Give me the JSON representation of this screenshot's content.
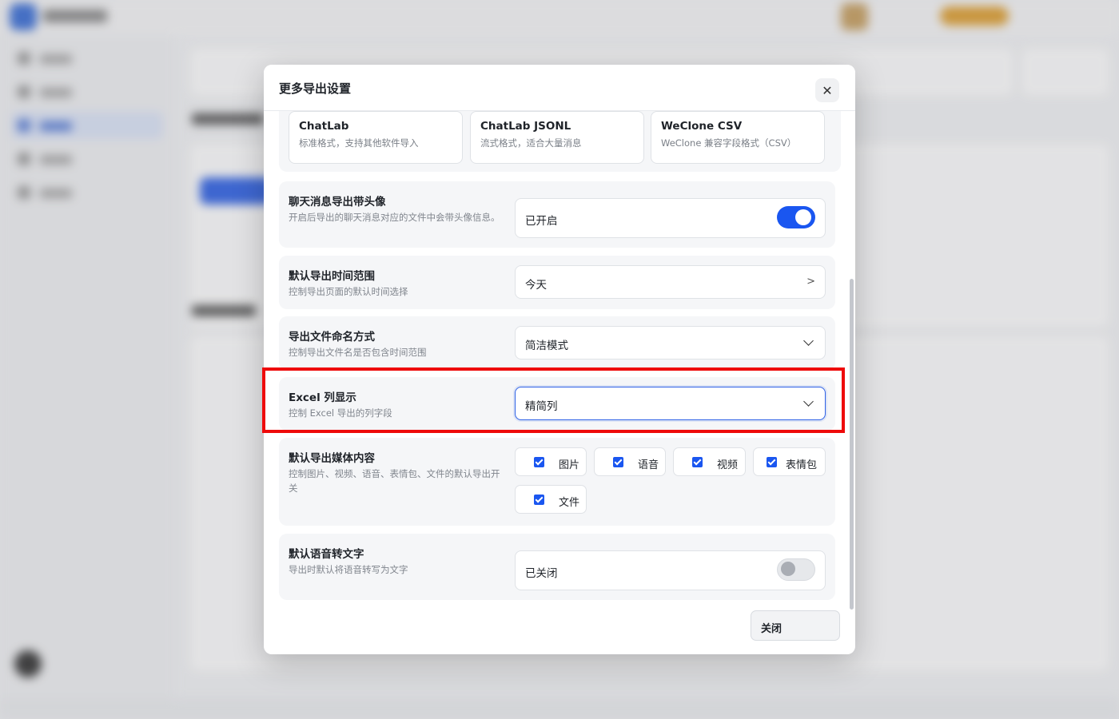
{
  "modal": {
    "title": "更多导出设置",
    "close_icon": "close-icon",
    "formats": [
      {
        "name": "ChatLab",
        "desc": "标准格式，支持其他软件导入"
      },
      {
        "name": "ChatLab JSONL",
        "desc": "流式格式，适合大量消息"
      },
      {
        "name": "WeClone CSV",
        "desc": "WeClone 兼容字段格式（CSV）"
      }
    ],
    "avatar": {
      "title": "聊天消息导出带头像",
      "desc": "开启后导出的聊天消息对应的文件中会带头像信息。",
      "status": "已开启",
      "enabled": true
    },
    "time_range": {
      "title": "默认导出时间范围",
      "desc": "控制导出页面的默认时间选择",
      "value": "今天",
      "arrow": ">"
    },
    "naming": {
      "title": "导出文件命名方式",
      "desc": "控制导出文件名是否包含时间范围",
      "value": "简洁模式"
    },
    "excel": {
      "title": "Excel 列显示",
      "desc": "控制 Excel 导出的列字段",
      "value": "精简列"
    },
    "media": {
      "title": "默认导出媒体内容",
      "desc": "控制图片、视频、语音、表情包、文件的默认导出开关",
      "options": [
        {
          "label": "图片",
          "checked": true
        },
        {
          "label": "语音",
          "checked": true
        },
        {
          "label": "视频",
          "checked": true
        },
        {
          "label": "表情包",
          "checked": true
        },
        {
          "label": "文件",
          "checked": true
        }
      ]
    },
    "voice_to_text": {
      "title": "默认语音转文字",
      "desc": "导出时默认将语音转写为文字",
      "status": "已关闭",
      "enabled": false
    },
    "close_button": "关闭"
  },
  "colors": {
    "accent": "#1a56f0",
    "highlight": "#ee0a0a"
  }
}
